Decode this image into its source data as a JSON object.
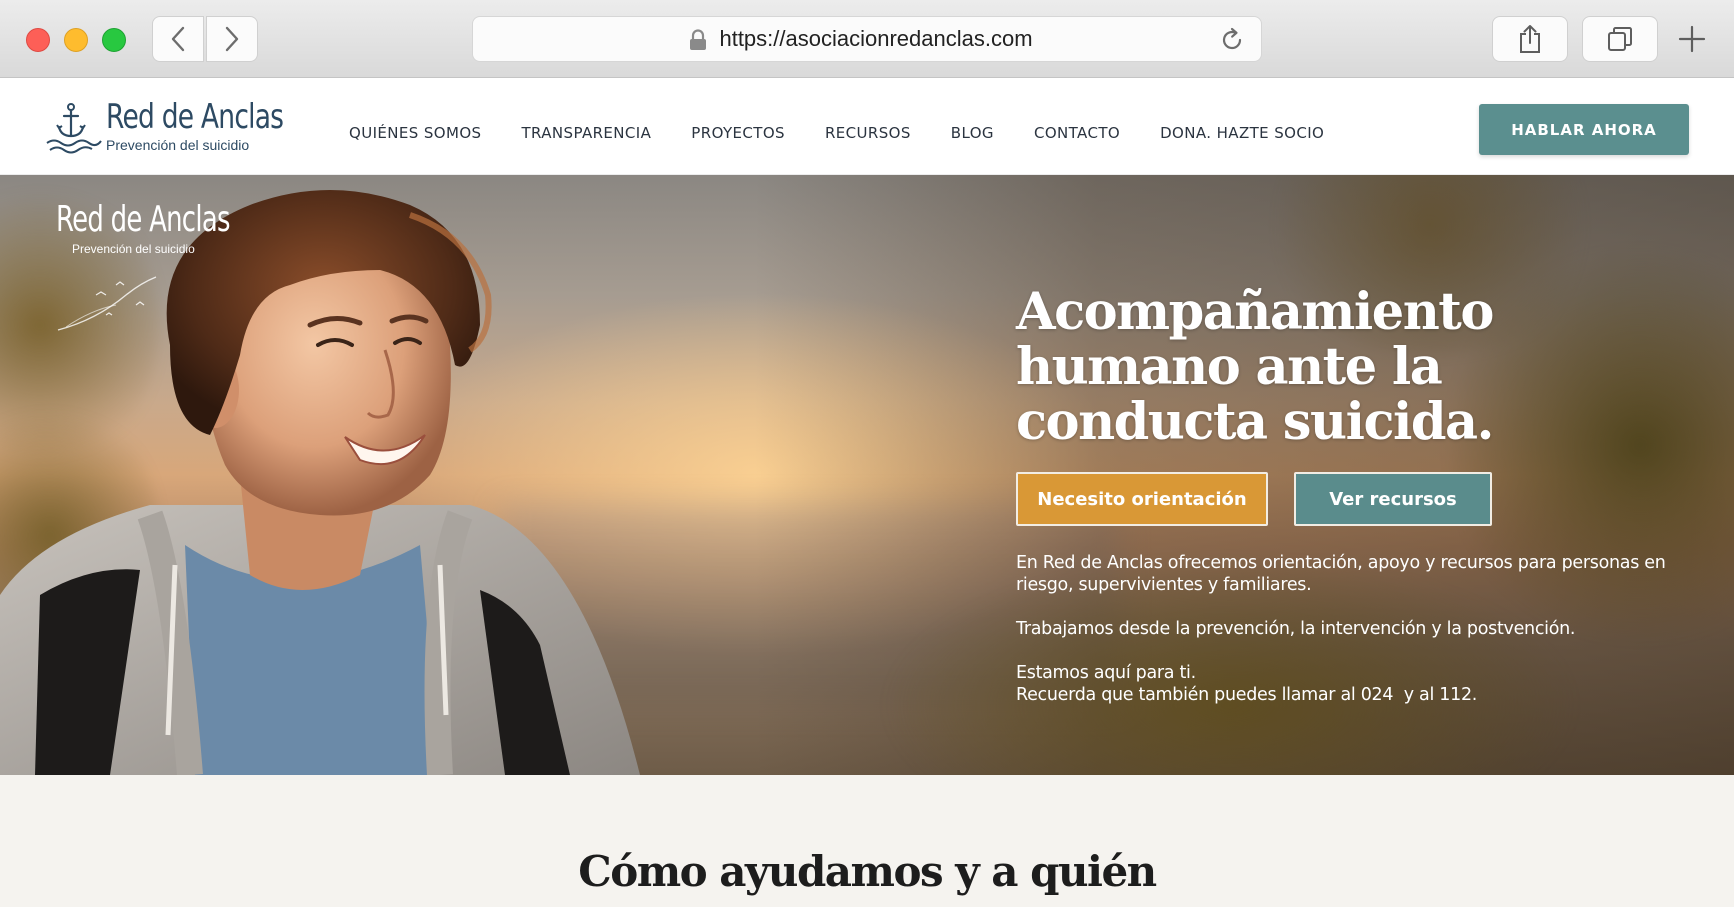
{
  "browser": {
    "url": "https://asociacionredanclas.com"
  },
  "header": {
    "logo_title": "Red de Anclas",
    "logo_subtitle": "Prevención del suicidio",
    "nav": [
      "QUIÉNES SOMOS",
      "TRANSPARENCIA",
      "PROYECTOS",
      "RECURSOS",
      "BLOG",
      "CONTACTO",
      "DONA. HAZTE SOCIO"
    ],
    "cta": "HABLAR AHORA"
  },
  "hero": {
    "overlay_logo_title": "Red de Anclas",
    "overlay_logo_subtitle": "Prevención del suicidio",
    "title": "Acompañamiento humano ante la conducta suicida.",
    "button_primary": "Necesito orientación",
    "button_secondary": "Ver recursos",
    "paragraph_1": "En Red de Anclas ofrecemos orientación, apoyo y recursos para personas en riesgo, supervivientes y familiares.",
    "paragraph_2": "Trabajamos desde la prevención, la intervención y la postvención.",
    "paragraph_3_line_1": "Estamos aquí para ti.",
    "paragraph_3_line_2": "Recuerda que también puedes llamar al 024  y al 112."
  },
  "section": {
    "title": "Cómo ayudamos y a quién"
  },
  "colors": {
    "brand_navy": "#2d4a63",
    "teal": "#5b8f8f",
    "orange": "#d99836"
  }
}
